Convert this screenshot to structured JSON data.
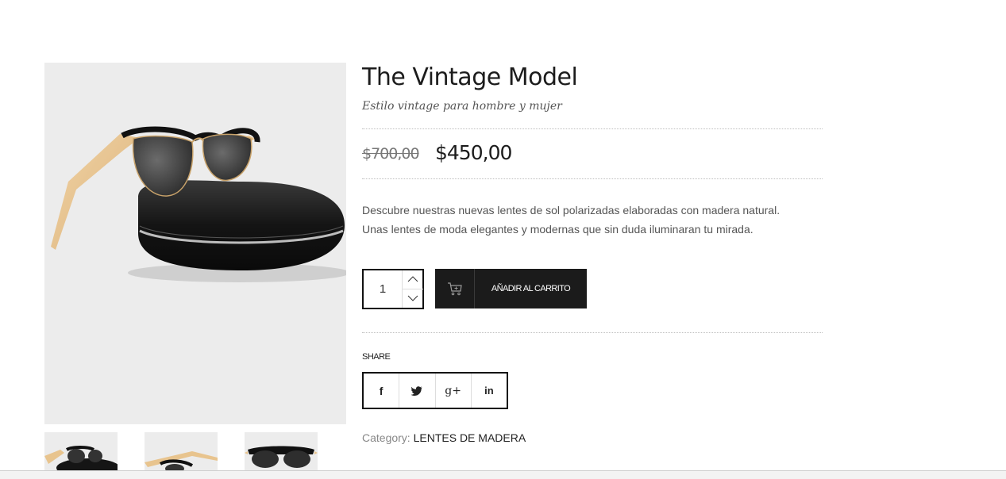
{
  "product": {
    "title": "The Vintage Model",
    "subtitle": "Estilo vintage para hombre y mujer",
    "price_old": "$700,00",
    "price_new": "$450,00",
    "description_line1": "Descubre nuestras nuevas lentes de sol polarizadas elaboradas con madera natural.",
    "description_line2": "Unas lentes de moda elegantes y modernas que sin duda iluminaran tu mirada.",
    "quantity": "1",
    "add_to_cart_label": "AÑADIR AL CARRITO"
  },
  "share": {
    "label": "SHARE",
    "icons": [
      "facebook-icon",
      "twitter-icon",
      "google-plus-icon",
      "linkedin-icon"
    ],
    "glyphs": [
      "f",
      "t",
      "g+",
      "in"
    ]
  },
  "category": {
    "label": "Category:",
    "value": "LENTES DE MADERA"
  },
  "colors": {
    "button_bg": "#1b1b1b",
    "text_dark": "#1c1c1c",
    "text_muted": "#888888",
    "image_bg": "#ececec",
    "wood": "#e8c48e"
  }
}
